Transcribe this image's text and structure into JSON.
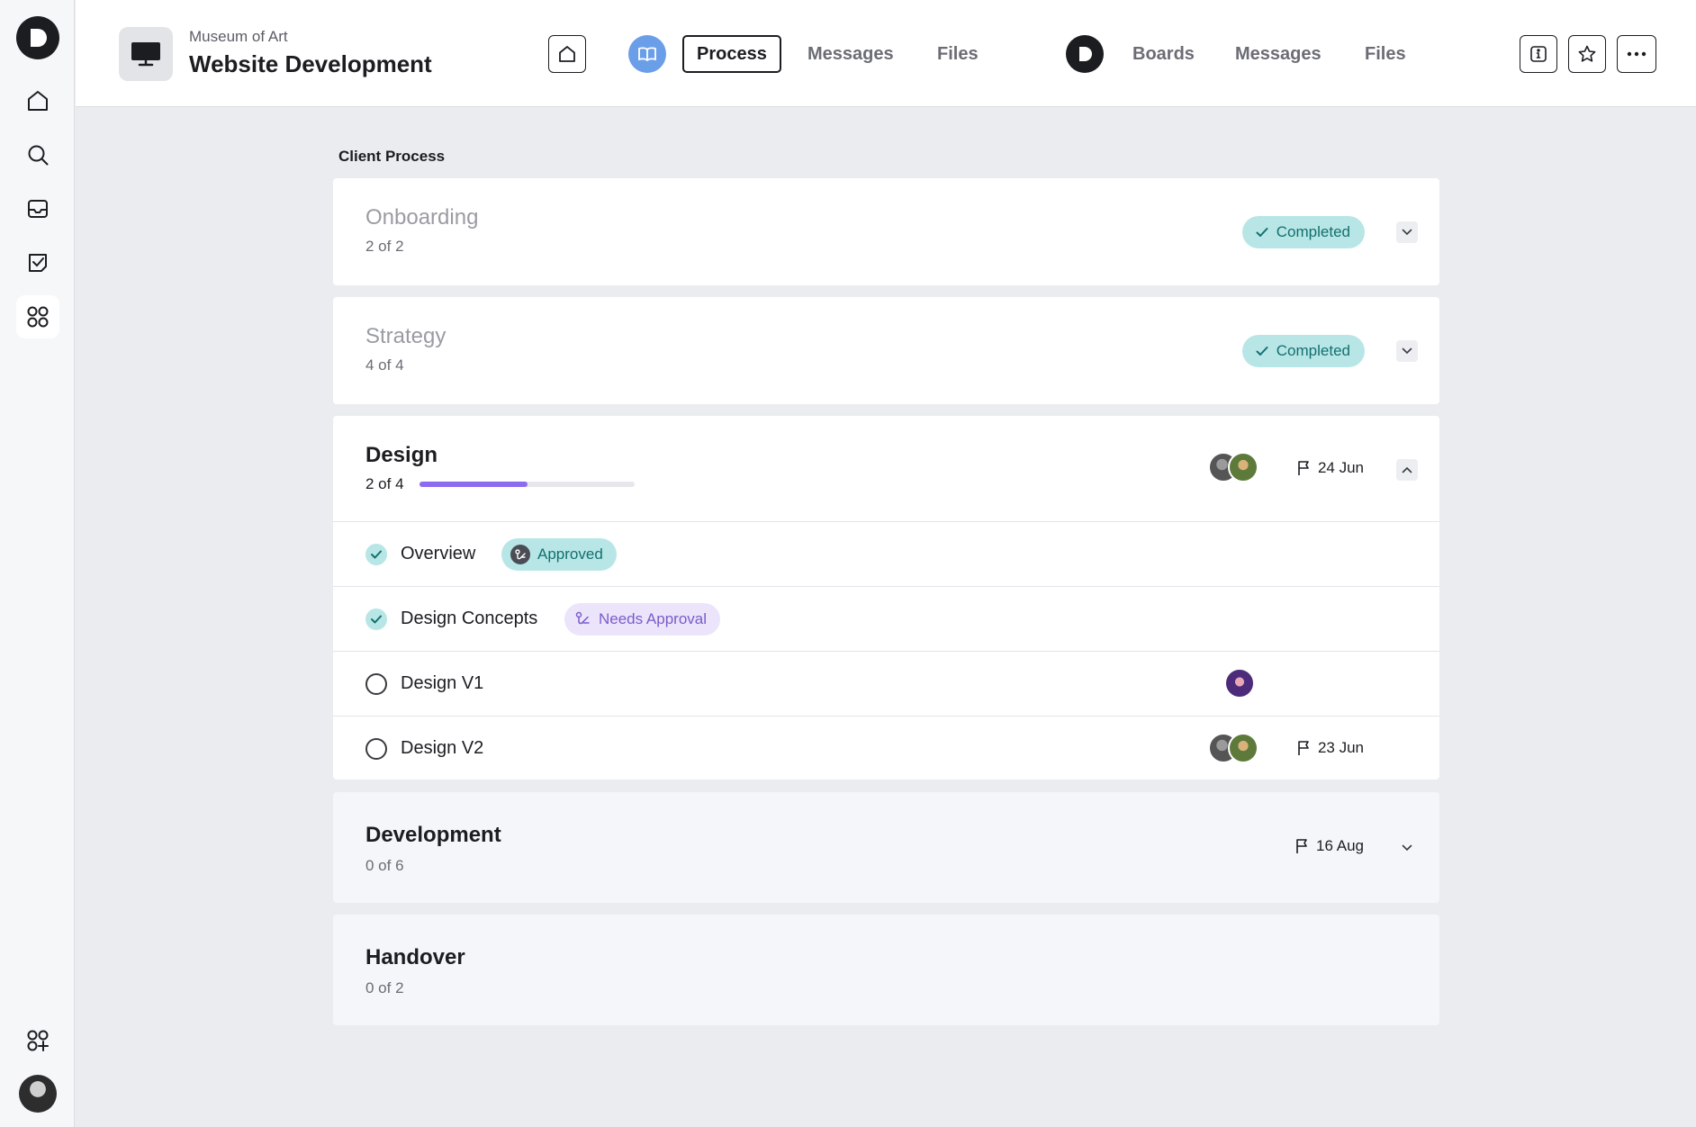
{
  "header": {
    "subtitle": "Museum of Art",
    "title": "Website Development",
    "tabs_group1": [
      {
        "label": "Process",
        "active": true
      },
      {
        "label": "Messages",
        "active": false
      },
      {
        "label": "Files",
        "active": false
      }
    ],
    "tabs_group2": [
      {
        "label": "Boards"
      },
      {
        "label": "Messages"
      },
      {
        "label": "Files"
      }
    ]
  },
  "section_title": "Client Process",
  "stages": {
    "onboarding": {
      "name": "Onboarding",
      "count": "2 of 2",
      "status": "Completed"
    },
    "strategy": {
      "name": "Strategy",
      "count": "4 of 4",
      "status": "Completed"
    },
    "design": {
      "name": "Design",
      "count": "2 of 4",
      "progress": 0.5,
      "due": "24 Jun",
      "tasks": [
        {
          "label": "Overview",
          "done": true,
          "badge": "Approved"
        },
        {
          "label": "Design Concepts",
          "done": true,
          "badge": "Needs Approval"
        },
        {
          "label": "Design V1",
          "done": false
        },
        {
          "label": "Design V2",
          "done": false,
          "due": "23 Jun"
        }
      ]
    },
    "development": {
      "name": "Development",
      "count": "0 of 6",
      "due": "16 Aug"
    },
    "handover": {
      "name": "Handover",
      "count": "0 of 2"
    }
  },
  "colors": {
    "accent_teal": "#b8e6e6",
    "accent_purple": "#8b6cf0",
    "workspace_blue": "#6b9ee8"
  }
}
